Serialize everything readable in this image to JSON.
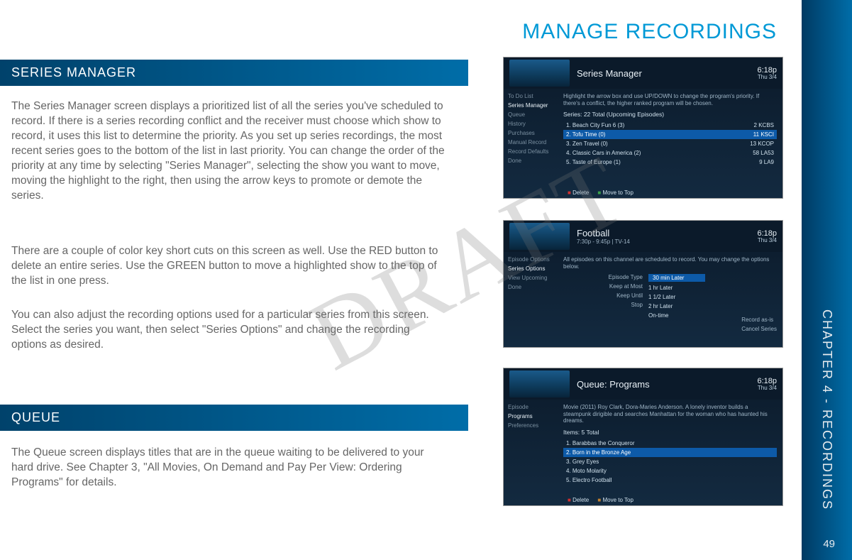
{
  "watermark": "DRAFT",
  "main_heading": "MANAGE RECORDINGS",
  "side_tab": "CHAPTER 4 - RECORDINGS",
  "page_number": "49",
  "sections": {
    "series_manager": {
      "title": "SERIES MANAGER",
      "p1": "The Series Manager screen displays a prioritized list of all the series you've scheduled to record. If there is a series recording conflict and the receiver must choose which show to record, it uses this list to determine the priority. As you set up series recordings, the most recent series goes to the bottom of the list in last priority. You can change the order of the priority at any time by selecting \"Series Manager\", selecting the show you want to move, moving the highlight to the right, then using the arrow keys to promote or demote the series.",
      "p2": "There are a couple of color key short cuts on this screen as well. Use the RED button to delete an entire series. Use the GREEN button to move a highlighted show to the top of the list in one press.",
      "p3": "You can also adjust the recording options used for a particular series from this screen. Select the series you want, then select \"Series Options\" and change the recording options as desired."
    },
    "queue": {
      "title": "QUEUE",
      "p1": "The Queue screen displays titles that are in the queue waiting to be delivered to your hard drive. See Chapter 3, \"All Movies, On Demand and Pay Per View: Ordering Programs\" for details."
    }
  },
  "screenshots": {
    "s1": {
      "title": "Series Manager",
      "time": "6:18p",
      "date": "Thu 3/4",
      "caption": "Highlight the arrow box and use UP/DOWN to change the program's priority. If there's a conflict, the higher ranked program will be chosen.",
      "subhead": "Series: 22 Total (Upcoming Episodes)",
      "side": [
        "To Do List",
        "Series Manager",
        "Queue",
        "History",
        "Purchases",
        "Manual Record",
        "Record Defaults",
        "Done"
      ],
      "side_hl": 1,
      "rows": [
        {
          "n": "1.",
          "t": "Beach City Fun 6 (3)",
          "c": "2 KCBS"
        },
        {
          "n": "2.",
          "t": "Tofu Time (0)",
          "c": "11 KSCI"
        },
        {
          "n": "3.",
          "t": "Zen Travel (0)",
          "c": "13 KCOP"
        },
        {
          "n": "4.",
          "t": "Classic Cars in America (2)",
          "c": "58 LA53"
        },
        {
          "n": "5.",
          "t": "Taste of Europe (1)",
          "c": "9 LA9"
        }
      ],
      "sel_index": 1,
      "footer": {
        "red": "Delete",
        "green": "Move to Top"
      }
    },
    "s2": {
      "title": "Football",
      "sub": "7:30p - 9:45p | TV-14",
      "time": "6:18p",
      "date": "Thu 3/4",
      "caption": "All episodes on this channel are scheduled to record. You may change the options below.",
      "side": [
        "Episode Options",
        "Series Options",
        "View Upcoming",
        "Done"
      ],
      "side_hl": 1,
      "labels": [
        "Episode Type",
        "Keep at Most",
        "Keep Until",
        "Stop"
      ],
      "values": [
        "30 min Later",
        "1 hr Later",
        "1 1/2 Later",
        "2 hr Later",
        "On-time"
      ],
      "sel_index": 0,
      "rightcol": [
        "Record as-is",
        "Cancel Series"
      ]
    },
    "s3": {
      "title": "Queue: Programs",
      "time": "6:18p",
      "date": "Thu 3/4",
      "caption": "Movie (2011) Roy Clark, Dora-Maries Anderson. A lonely inventor builds a steampunk dirigible and searches Manhattan for the woman who has haunted his dreams.",
      "subhead": "Items: 5 Total",
      "side": [
        "Episode",
        "Programs",
        "Preferences"
      ],
      "side_hl": 1,
      "rows": [
        {
          "n": "1.",
          "t": "Barabbas the Conqueror"
        },
        {
          "n": "2.",
          "t": "Born in the Bronze Age"
        },
        {
          "n": "3.",
          "t": "Grey Eyes"
        },
        {
          "n": "4.",
          "t": "Moto Molarity"
        },
        {
          "n": "5.",
          "t": "Electro Football"
        }
      ],
      "sel_index": 1,
      "footer": {
        "red": "Delete",
        "orange": "Move to Top"
      }
    }
  }
}
